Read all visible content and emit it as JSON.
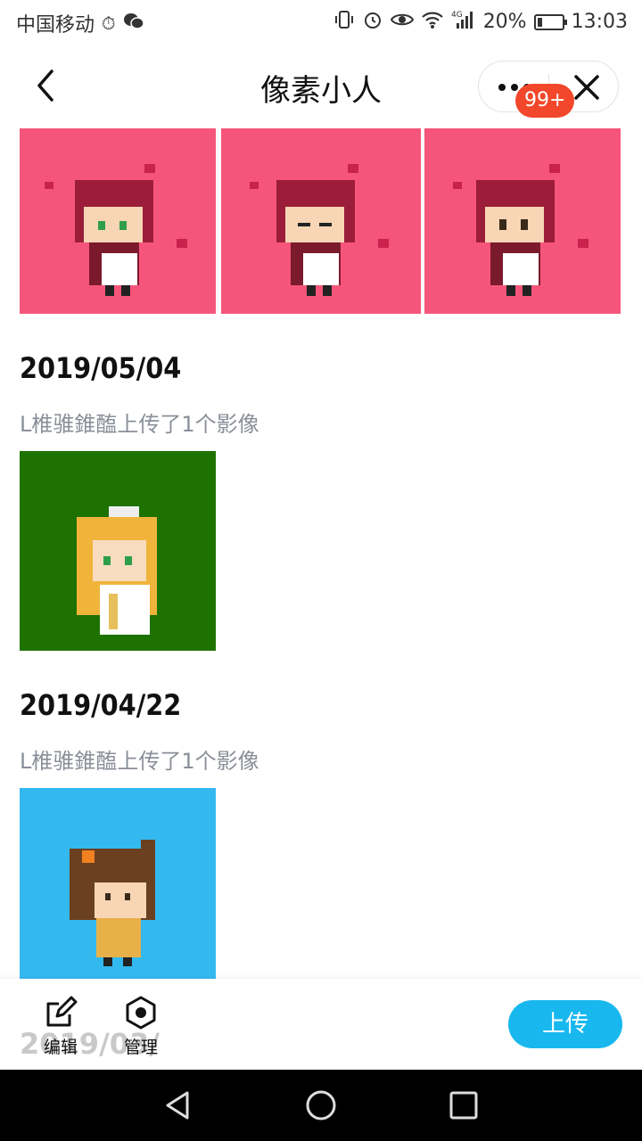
{
  "status": {
    "carrier": "中国移动",
    "network": "4G",
    "battery_percent": "20%",
    "battery_level": 0.2,
    "time": "13:03"
  },
  "header": {
    "title": "像素小人",
    "badge": "99+"
  },
  "feed": {
    "top_row_colors": [
      "#f6557b",
      "#f6557b",
      "#f6557b"
    ],
    "entries": [
      {
        "date": "2019/05/04",
        "caption": "L椎骓錐醢上传了1个影像",
        "image_bg": "#1d7200"
      },
      {
        "date": "2019/04/22",
        "caption": "L椎骓錐醢上传了1个影像",
        "image_bg": "#33b9f0"
      }
    ]
  },
  "bottom": {
    "edit_label": "编辑",
    "manage_label": "管理",
    "upload_label": "上传",
    "ghost_date": "2019/03/"
  },
  "colors": {
    "accent": "#18b8ef",
    "badge": "#f2472b",
    "pink": "#f6557b",
    "green": "#1d7200",
    "blue": "#33b9f0"
  }
}
